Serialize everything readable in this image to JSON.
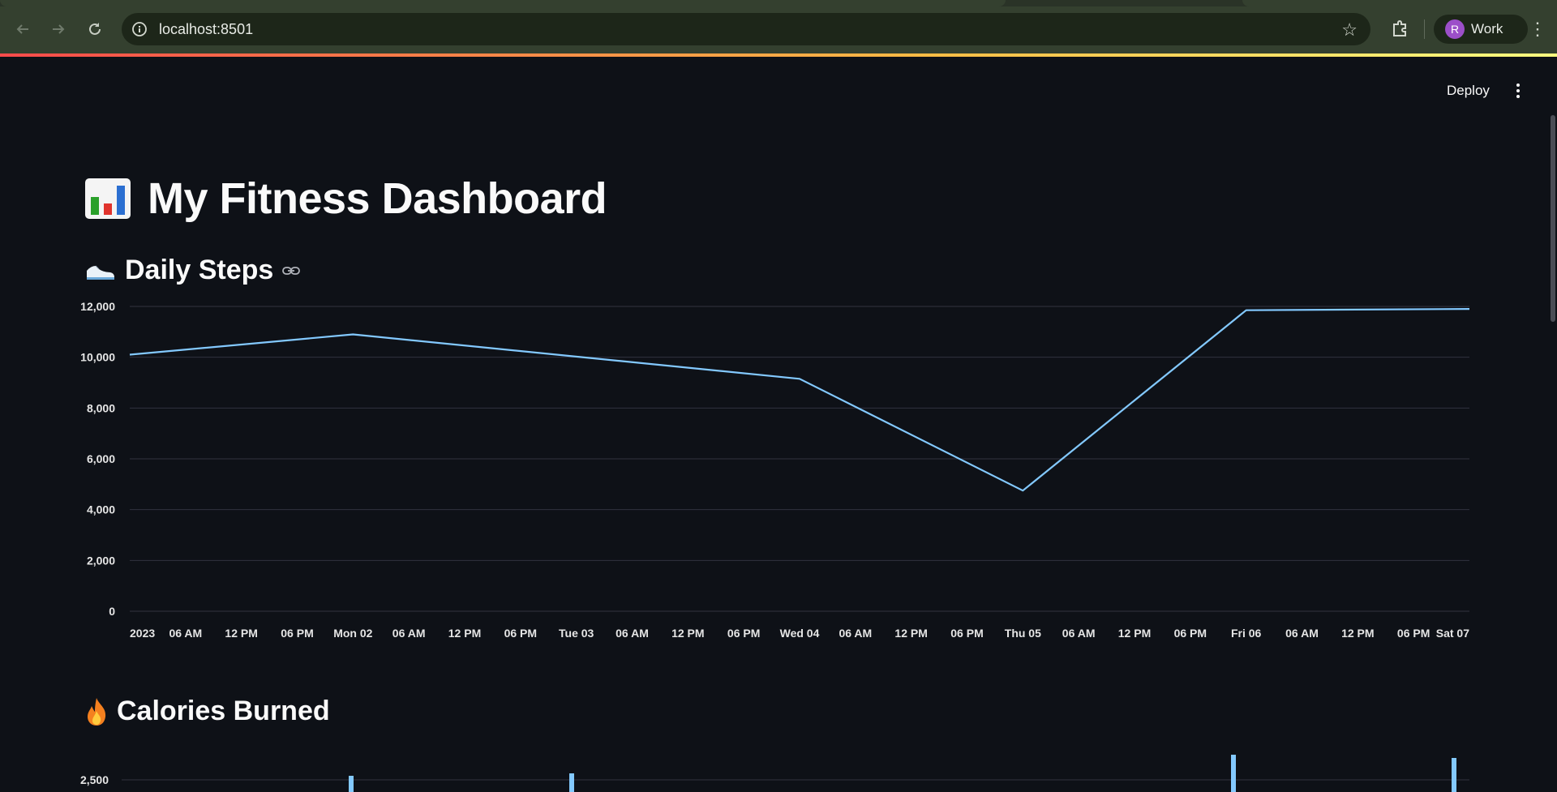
{
  "browser": {
    "url": "localhost:8501",
    "profile_initial": "R",
    "profile_name": "Work"
  },
  "app": {
    "deploy_label": "Deploy",
    "title_icon": "bar-chart-emoji",
    "title": "My Fitness Dashboard",
    "sections": [
      {
        "icon": "sneaker-emoji",
        "heading": "Daily Steps"
      },
      {
        "icon": "fire-emoji",
        "heading": "Calories Burned"
      }
    ]
  },
  "colors": {
    "background": "#0e1117",
    "line": "#83c9ff",
    "grid": "#31333f",
    "decor_start": "#ff4b4b",
    "decor_end": "#fffd80"
  },
  "chart_data": [
    {
      "type": "line",
      "title": "Daily Steps",
      "x": [
        "2023-01-01",
        "2023-01-02",
        "2023-01-04",
        "2023-01-05",
        "2023-01-06",
        "2023-01-07"
      ],
      "series": [
        {
          "values": [
            10100,
            10900,
            9150,
            4750,
            11850,
            11900
          ]
        }
      ],
      "ylim": [
        0,
        12000
      ],
      "yticks": [
        0,
        2000,
        4000,
        6000,
        8000,
        10000,
        12000
      ],
      "ytick_labels": [
        "0",
        "2,000",
        "4,000",
        "6,000",
        "8,000",
        "10,000",
        "12,000"
      ],
      "xtick_labels": [
        "2023",
        "06 AM",
        "12 PM",
        "06 PM",
        "Mon 02",
        "06 AM",
        "12 PM",
        "06 PM",
        "Tue 03",
        "06 AM",
        "12 PM",
        "06 PM",
        "Wed 04",
        "06 AM",
        "12 PM",
        "06 PM",
        "Thu 05",
        "06 AM",
        "12 PM",
        "06 PM",
        "Fri 06",
        "06 AM",
        "12 PM",
        "06 PM",
        "Sat 07"
      ],
      "grid": true
    },
    {
      "type": "bar",
      "title": "Calories Burned",
      "ytick_labels": [
        "2,500"
      ]
    }
  ]
}
